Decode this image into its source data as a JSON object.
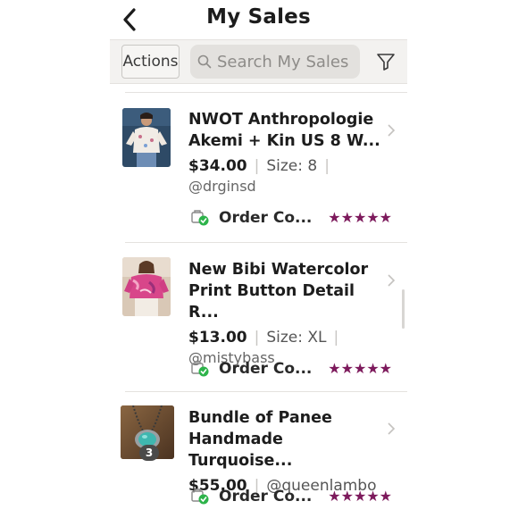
{
  "header": {
    "title": "My Sales",
    "back_icon": "chevron-left-icon"
  },
  "toolbar": {
    "actions_label": "Actions",
    "search_placeholder": "Search My Sales",
    "search_value": "",
    "filter_icon": "filter-funnel-icon"
  },
  "colors": {
    "star": "#7d1a5c",
    "status_check": "#2db34a",
    "toolbar_bg": "#f3f2f0"
  },
  "sales": [
    {
      "title": "NWOT Anthropologie Akemi + Kin US 8 W...",
      "price": "$34.00",
      "size": "Size: 8",
      "seller": "@drginsd",
      "status": "Order Co...",
      "rating": 5,
      "stars": "★★★★★",
      "bundle_count": null
    },
    {
      "title": "New Bibi Watercolor Print Button Detail R...",
      "price": "$13.00",
      "size": "Size: XL",
      "seller": "@mistybass",
      "status": "Order Co...",
      "rating": 5,
      "stars": "★★★★★",
      "bundle_count": null
    },
    {
      "title": "Bundle of Panee Handmade Turquoise...",
      "price": "$55.00",
      "size": "",
      "seller": "@queenlambo",
      "status": "Order Co...",
      "rating": 5,
      "stars": "★★★★★",
      "bundle_count": "3"
    }
  ]
}
